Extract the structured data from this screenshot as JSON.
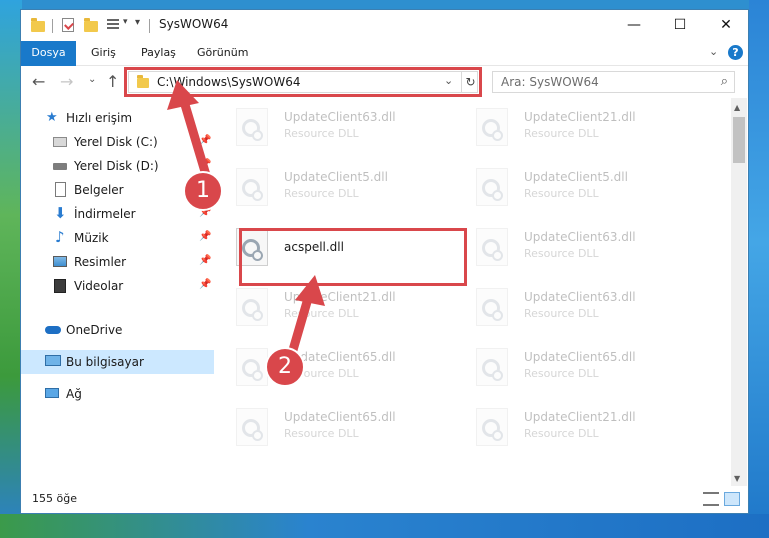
{
  "window": {
    "title": "SysWOW64",
    "controls": {
      "minimize": "—",
      "maximize": "☐",
      "close": "✕"
    }
  },
  "ribbon": {
    "tabs": [
      "Dosya",
      "Giriş",
      "Paylaş",
      "Görünüm"
    ],
    "expand_glyph": "⌄",
    "help_glyph": "?"
  },
  "nav": {
    "back": "←",
    "forward": "→",
    "recent": "⌄",
    "up": "↑",
    "address": "C:\\Windows\\SysWOW64",
    "address_dropdown": "⌄",
    "refresh": "↻",
    "search_placeholder": "Ara: SysWOW64",
    "search_icon": "⌕"
  },
  "sidebar": {
    "pin_glyph": "📌",
    "items": [
      {
        "label": "Hızlı erişim",
        "icon": "star-icon"
      },
      {
        "label": "Yerel Disk (C:)",
        "icon": "drive-icon"
      },
      {
        "label": "Yerel Disk (D:)",
        "icon": "drive-icon"
      },
      {
        "label": "Belgeler",
        "icon": "documents-icon"
      },
      {
        "label": "İndirmeler",
        "icon": "download-icon"
      },
      {
        "label": "Müzik",
        "icon": "music-icon"
      },
      {
        "label": "Resimler",
        "icon": "pictures-icon"
      },
      {
        "label": "Videolar",
        "icon": "videos-icon"
      },
      {
        "label": "OneDrive",
        "icon": "cloud-icon"
      },
      {
        "label": "Bu bilgisayar",
        "icon": "computer-icon"
      },
      {
        "label": "Ağ",
        "icon": "network-icon"
      }
    ]
  },
  "files": [
    {
      "name": "UpdateClient63.dll",
      "type": "Resource DLL"
    },
    {
      "name": "UpdateClient21.dll",
      "type": "Resource DLL"
    },
    {
      "name": "UpdateClient5.dll",
      "type": "Resource DLL"
    },
    {
      "name": "UpdateClient5.dll",
      "type": "Resource DLL"
    },
    {
      "name": "acspell.dll",
      "type": ""
    },
    {
      "name": "UpdateClient63.dll",
      "type": "Resource DLL"
    },
    {
      "name": "UpdateClient21.dll",
      "type": "Resource DLL"
    },
    {
      "name": "UpdateClient63.dll",
      "type": "Resource DLL"
    },
    {
      "name": "UpdateClient65.dll",
      "type": "Resource DLL"
    },
    {
      "name": "UpdateClient65.dll",
      "type": "Resource DLL"
    },
    {
      "name": "UpdateClient65.dll",
      "type": "Resource DLL"
    },
    {
      "name": "UpdateClient21.dll",
      "type": "Resource DLL"
    }
  ],
  "status": {
    "count": "155 öğe"
  },
  "annotations": {
    "step1": "1",
    "step2": "2",
    "accent": "#d9474b"
  },
  "colors": {
    "accent_blue": "#1979ca",
    "selection": "#cce8ff"
  }
}
